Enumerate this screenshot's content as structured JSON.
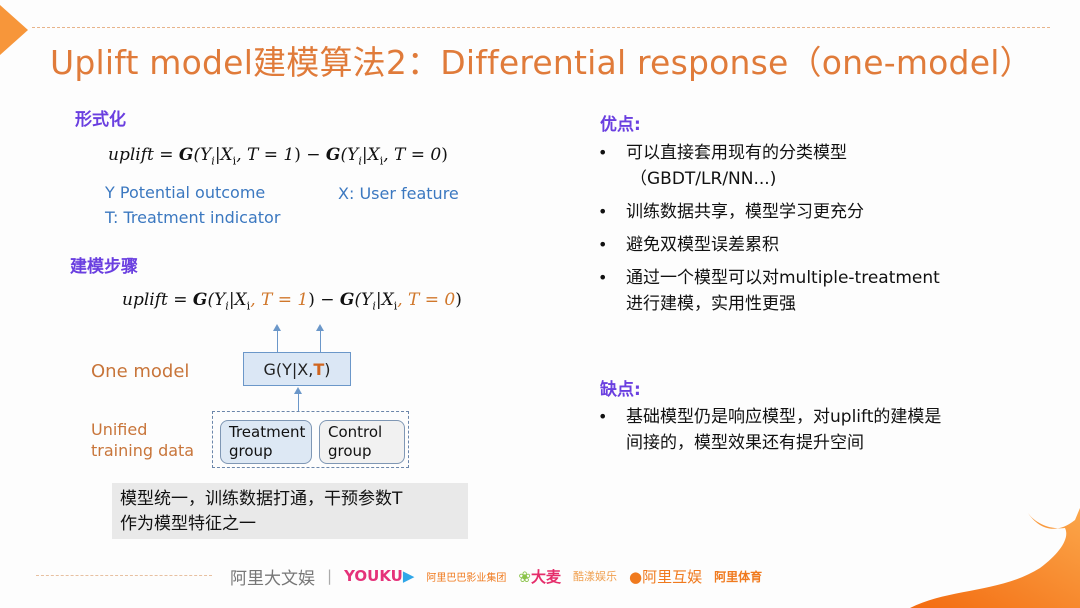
{
  "title": "Uplift model建模算法2：Differential response（one-model）",
  "left": {
    "formalization": {
      "heading": "形式化",
      "formula": {
        "lhs": "uplift",
        "eq": " = ",
        "G": "G",
        "term1_open": "(Y",
        "sub_i": "i",
        "bar_x": "|X",
        "sub_x": "i",
        "t1": ", T = 1",
        "close": ")",
        "minus": " − ",
        "t0": ", T = 0"
      },
      "legend": {
        "y": "Y Potential outcome",
        "x": "X: User feature",
        "t": "T: Treatment indicator"
      }
    },
    "steps": {
      "heading": "建模步骤",
      "one_model_label": "One model",
      "model_box": {
        "prefix": "G(Y|X,",
        "t": "T",
        "suffix": ")"
      },
      "unified_label_line1": "Unified",
      "unified_label_line2": "training data",
      "groups": [
        {
          "line1": "Treatment",
          "line2": "group"
        },
        {
          "line1": "Control",
          "line2": "group"
        }
      ],
      "note_line1": "模型统一，训练数据打通，干预参数T",
      "note_line2": "作为模型特征之一"
    }
  },
  "right": {
    "pros": {
      "heading": "优点:",
      "items": [
        {
          "line1": "可以直接套用现有的分类模型",
          "line2": "（GBDT/LR/NN...)"
        },
        {
          "line1": "训练数据共享，模型学习更充分",
          "line2": ""
        },
        {
          "line1": "避免双模型误差累积",
          "line2": ""
        },
        {
          "line1": "通过一个模型可以对multiple-treatment",
          "line2": "进行建模，实用性更强"
        }
      ]
    },
    "cons": {
      "heading": "缺点:",
      "items": [
        {
          "line1": "基础模型仍是响应模型，对uplift的建模是",
          "line2": "间接的，模型效果还有提升空间"
        }
      ]
    }
  },
  "footer": {
    "logos": [
      "阿里大文娱",
      "|",
      "YOUKU",
      "阿里巴巴影业集团",
      "大麦",
      "酷漾娱乐",
      "阿里互娱",
      "阿里体育"
    ]
  },
  "colors": {
    "title": "#e07b3a",
    "heading": "#6a3fe0",
    "legend": "#3b78c0",
    "accent": "#f7963a"
  }
}
